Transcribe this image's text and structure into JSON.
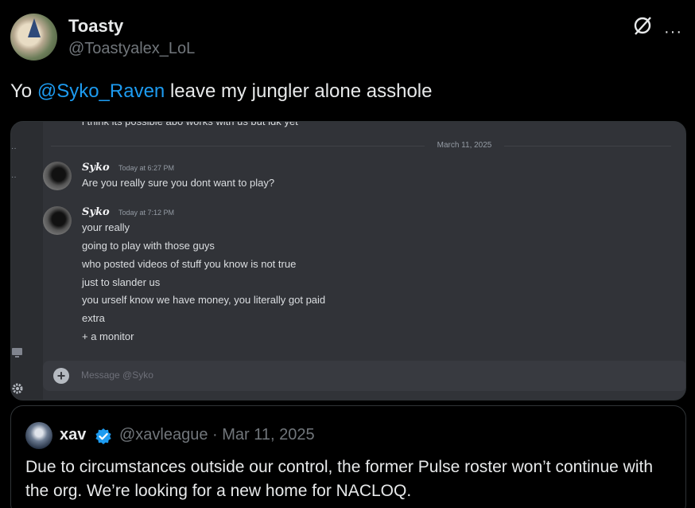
{
  "author": {
    "display_name": "Toasty",
    "handle": "@Toastyalex_LoL"
  },
  "header_icons": [
    "grok-icon",
    "more-icon"
  ],
  "more_glyph": "···",
  "tweet": {
    "prefix": "Yo ",
    "mention": "@Syko_Raven",
    "suffix": " leave my jungler alone asshole"
  },
  "discord": {
    "cut_text": "i think its possible abo works with us but idk yet",
    "date_divider": "March 11, 2025",
    "messages": [
      {
        "name": "Syko",
        "time": "Today at 6:27 PM",
        "lines": [
          "Are you really sure you dont want to play?"
        ]
      },
      {
        "name": "Syko",
        "time": "Today at 7:12 PM",
        "lines": [
          "your really",
          "going to play with those guys",
          "who posted videos of stuff you know is not true",
          "just to slander us",
          "you urself know we have money, you literally got paid",
          "extra",
          "+ a monitor"
        ]
      }
    ],
    "composer_placeholder": "Message @Syko",
    "plus_glyph": "+"
  },
  "quoted_tweet": {
    "display_name": "xav",
    "meta": "@xavleague · Mar 11, 2025",
    "text": "Due to circumstances outside our control, the former Pulse roster won’t continue with the org. We’re looking for a new home for NACLOQ."
  },
  "colors": {
    "background": "#000000",
    "mention_blue": "#1d9bf0",
    "discord_bg": "#313338",
    "verified": "#1d9bf0"
  }
}
